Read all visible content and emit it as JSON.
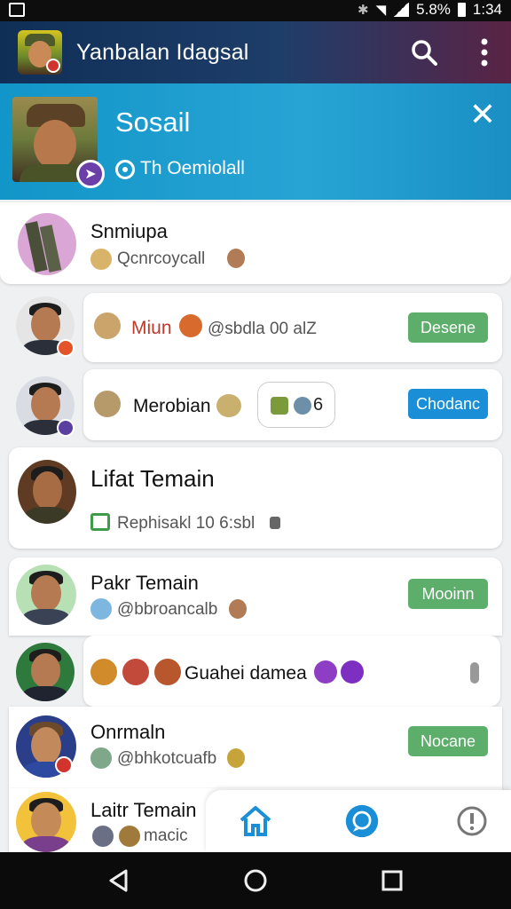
{
  "status_bar": {
    "battery": "5.8%",
    "time": "1:34"
  },
  "app_bar": {
    "title": "Yanbalan Idagsal"
  },
  "hero": {
    "title": "Sosail",
    "subtitle": "Th Oemiolall"
  },
  "rows": [
    {
      "name": "Snmiupa",
      "subtitle": "Qcnrcoycall"
    },
    {
      "name": "Miun",
      "subtitle": "@sbdla 00 alZ",
      "action": "Desene"
    },
    {
      "name": "Merobian",
      "counter": "6",
      "action": "Chodanc"
    },
    {
      "name": "Lifat Temain",
      "subtitle": "Rephisakl 10 6:sbl"
    },
    {
      "name": "Pakr Temain",
      "subtitle": "@bbroancalb",
      "action": "Mooinn"
    },
    {
      "name": "Guahei damea"
    },
    {
      "name": "Onrmaln",
      "subtitle": "@bhkotcuafb",
      "action": "Nocane"
    },
    {
      "name": "Laitr Temain",
      "subtitle": "macic"
    }
  ],
  "colors": {
    "app_bar": "#0f2f57",
    "hero": "#1e9fd0",
    "green_pill": "#5cae6a",
    "blue_pill": "#1a8ed6",
    "miun_red": "#c0392b"
  }
}
